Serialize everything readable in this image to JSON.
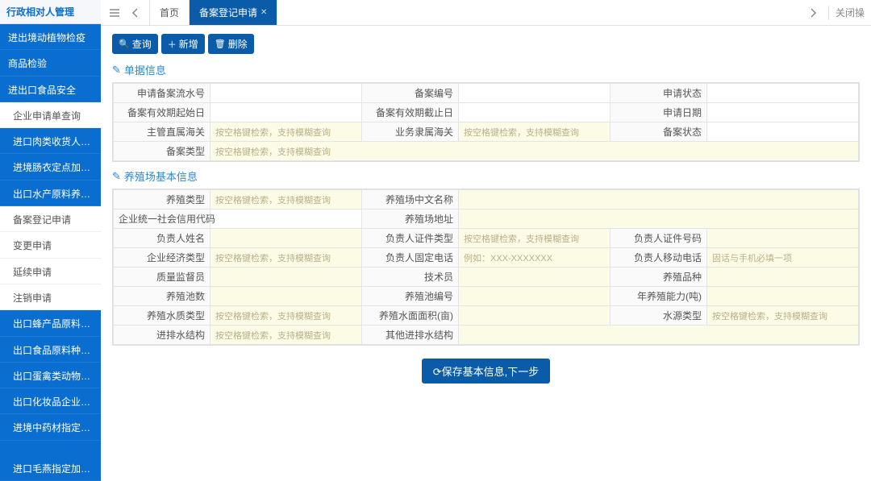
{
  "sidebar": {
    "title": "行政相对人管理",
    "items": [
      {
        "label": "进出境动植物检疫",
        "style": "active",
        "lvl": 1
      },
      {
        "label": "商品检验",
        "style": "active",
        "lvl": 1
      },
      {
        "label": "进出口食品安全",
        "style": "active",
        "lvl": 1
      },
      {
        "label": "企业申请单查询",
        "style": "light",
        "lvl": 2
      },
      {
        "label": "进口肉类收货人备案",
        "style": "active",
        "lvl": 2
      },
      {
        "label": "进境肠衣定点加工企业备案",
        "style": "active",
        "lvl": 2
      },
      {
        "label": "出口水产原料养殖场备案",
        "style": "active",
        "lvl": 2
      },
      {
        "label": "备案登记申请",
        "style": "light",
        "lvl": 2
      },
      {
        "label": "变更申请",
        "style": "light",
        "lvl": 2
      },
      {
        "label": "延续申请",
        "style": "light",
        "lvl": 2
      },
      {
        "label": "注销申请",
        "style": "light",
        "lvl": 2
      },
      {
        "label": "出口蜂产品原料养殖场备案",
        "style": "active",
        "lvl": 2
      },
      {
        "label": "出口食品原料种植场备案业务",
        "style": "active",
        "lvl": 2
      },
      {
        "label": "出口蛋禽类动物源性食品养殖",
        "style": "active",
        "lvl": 2
      },
      {
        "label": "出口化妆品企业备案",
        "style": "active",
        "lvl": 2
      },
      {
        "label": "进境中药材指定存放、加工",
        "style": "active",
        "lvl": 2
      },
      {
        "label": "进口毛燕指定加工企业备案",
        "style": "active",
        "lvl": 2
      }
    ]
  },
  "topbar": {
    "tab_home": "首页",
    "tab_active": "备案登记申请",
    "close_label": "关闭操"
  },
  "toolbar": {
    "search_label": "查询",
    "add_label": "新增",
    "delete_label": "删除"
  },
  "sections": {
    "s1": "单据信息",
    "s2": "养殖场基本信息"
  },
  "placeholders": {
    "fuzzy": "按空格键检索，支持模糊查询",
    "phone": "例如：XXX-XXXXXXX",
    "mobile": "固话与手机必填一项"
  },
  "form1": {
    "f1": "申请备案流水号",
    "f2": "备案编号",
    "f3": "申请状态",
    "f4": "备案有效期起始日",
    "f5": "备案有效期截止日",
    "f6": "申请日期",
    "f7": "主管直属海关",
    "f8": "业务隶属海关",
    "f9": "备案状态",
    "f10": "备案类型"
  },
  "form2": {
    "g1": "养殖类型",
    "g2": "养殖场中文名称",
    "g3": "企业统一社会信用代码",
    "g4": "养殖场地址",
    "g5": "负责人姓名",
    "g6": "负责人证件类型",
    "g7": "负责人证件号码",
    "g8": "企业经济类型",
    "g9": "负责人固定电话",
    "g10": "负责人移动电话",
    "g11": "质量监督员",
    "g12": "技术员",
    "g13": "养殖品种",
    "g14": "养殖池数",
    "g15": "养殖池编号",
    "g16": "年养殖能力(吨)",
    "g17": "养殖水质类型",
    "g18": "养殖水面面积(亩)",
    "g19": "水源类型",
    "g20": "进排水结构",
    "g21": "其他进排水结构"
  },
  "buttons": {
    "save_next": "保存基本信息,下一步"
  }
}
